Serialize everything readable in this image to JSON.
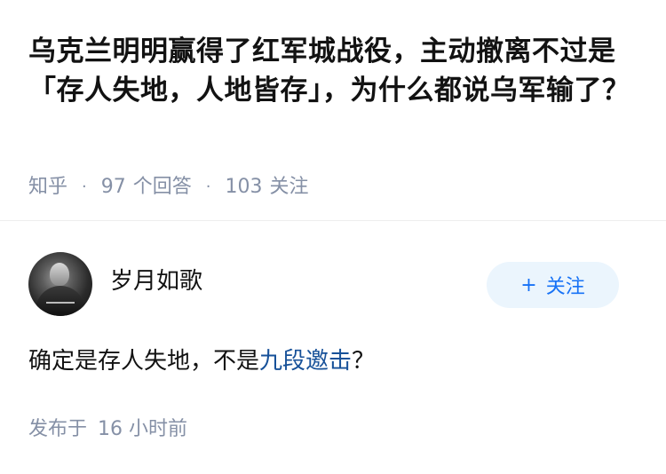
{
  "question": {
    "title": "乌克兰明明赢得了红军城战役，主动撤离不过是「存人失地，人地皆存」，为什么都说乌军输了？",
    "platform": "知乎",
    "answers_count": "97",
    "answers_label": "个回答",
    "followers_count": "103",
    "followers_label": "关注"
  },
  "answer": {
    "author_name": "岁月如歌",
    "follow_button": {
      "icon": "plus-icon",
      "label": "关注"
    },
    "text_before": "确定是存人失地，不是",
    "text_link": "九段邀击",
    "text_after": "？",
    "publish_prefix": "发布于",
    "publish_time": "16 小时前"
  },
  "colors": {
    "meta_gray": "#8590a6",
    "link_blue": "#175199",
    "button_blue": "#1772f6",
    "button_bg": "#ebf5fd"
  }
}
